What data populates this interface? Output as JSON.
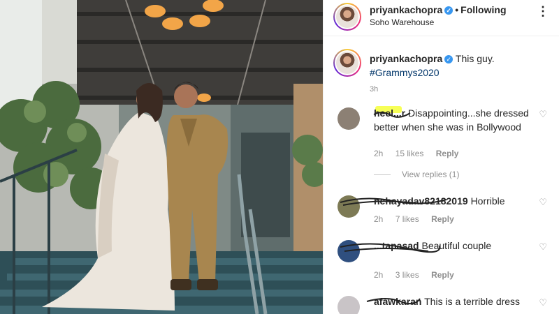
{
  "header": {
    "username": "priyankachopra",
    "verified_mark": "✓",
    "separator": "•",
    "follow_status": "Following",
    "location": "Soho Warehouse",
    "more_icon": "⋮"
  },
  "caption": {
    "username": "priyankachopra",
    "text": "This guy.",
    "hashtag": "#Grammys2020",
    "time": "3h"
  },
  "comments": [
    {
      "username": "heel...r",
      "text": "Disappointing...she dressed better when she was in Bollywood",
      "time": "2h",
      "likes": "15 likes",
      "reply": "Reply",
      "more": "···",
      "avatar_color": "#8c8074"
    },
    {
      "username": "nehayadav82182019",
      "text": "Horrible",
      "time": "2h",
      "likes": "7 likes",
      "reply": "Reply",
      "avatar_color": "#7d7a55"
    },
    {
      "username": "...tapasad",
      "text": "Beautiful couple",
      "time": "2h",
      "likes": "3 likes",
      "reply": "Reply",
      "avatar_color": "#2f4f7f"
    },
    {
      "username": "afawkaran",
      "text": "This is a terrible dress",
      "avatar_color": "#c9c4c7"
    }
  ],
  "view_replies": "View replies (1)",
  "icons": {
    "heart": "♡"
  },
  "colors": {
    "verified_blue": "#3897f0",
    "hashtag_blue": "#003569",
    "muted_gray": "#8e8e8e",
    "highlight_yellow": "#f6ff3a"
  }
}
